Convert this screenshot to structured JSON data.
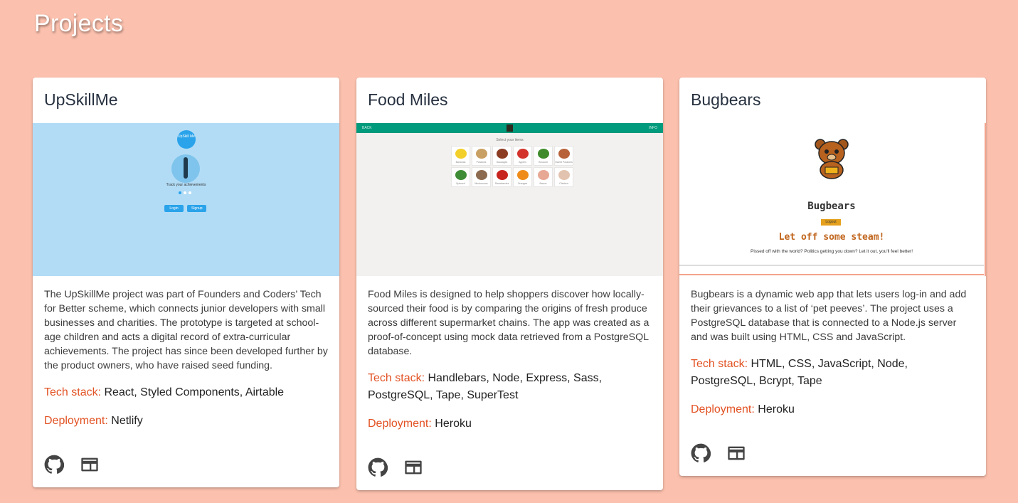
{
  "page": {
    "title": "Projects"
  },
  "colors": {
    "background": "#fcc1ae",
    "label": "#e25223",
    "card": "#ffffff"
  },
  "projects": [
    {
      "title": "UpSkillMe",
      "description": "The UpSkillMe project was part of Founders and Coders’ Tech for Better scheme, which connects junior developers with small businesses and charities. The prototype is targeted at school-age children and acts a digital record of extra-curricular achievements. The project has since been developed further by the product owners, who have raised seed funding.",
      "tech_label": "Tech stack:",
      "tech_stack": "React, Styled Components, Airtable",
      "deployment_label": "Deployment:",
      "deployment": "Netlify",
      "icons": [
        "github-icon",
        "web-app-icon"
      ],
      "preview": {
        "logo_text": "UpSkill Me",
        "tagline": "Track your achievements",
        "buttons": [
          "Login",
          "Signup"
        ]
      }
    },
    {
      "title": "Food Miles",
      "description": "Food Miles is designed to help shoppers discover how locally-sourced their food is by comparing the origins of fresh produce across different supermarket chains. The app was created as a proof-of-concept using mock data retrieved from a PostgreSQL database.",
      "tech_label": "Tech stack:",
      "tech_stack": "Handlebars, Node, Express, Sass, PostgreSQL, Tape, SuperTest",
      "deployment_label": "Deployment:",
      "deployment": "Heroku",
      "icons": [
        "github-icon",
        "web-app-icon"
      ],
      "preview": {
        "back": "BACK",
        "info": "INFO",
        "heading": "Select your items",
        "items": [
          "Bananas",
          "Potatoes",
          "Sausages",
          "Apples",
          "Broccoli",
          "Sweet Potatoes",
          "Spinach",
          "Mushrooms",
          "Strawberries",
          "Oranges",
          "Bacon",
          "Chicken"
        ],
        "item_colors": [
          "#f3cf2a",
          "#c9a064",
          "#8b3c22",
          "#d3332b",
          "#3f8b2c",
          "#b8623a",
          "#3e8d36",
          "#8c6a4f",
          "#c8241f",
          "#ef8c19",
          "#e7a894",
          "#e2c3b0"
        ]
      }
    },
    {
      "title": "Bugbears",
      "description": "Bugbears is a dynamic web app that lets users log-in and add their grievances to a list of ‘pet peeves’. The project uses a PostgreSQL database that is connected to a Node.js server and was built using HTML, CSS and JavaScript.",
      "tech_label": "Tech stack:",
      "tech_stack": "HTML, CSS, JavaScript, Node, PostgreSQL, Bcrypt, Tape",
      "deployment_label": "Deployment:",
      "deployment": "Heroku",
      "icons": [
        "github-icon",
        "web-app-icon"
      ],
      "preview": {
        "title": "Bugbears",
        "logout": "Logout",
        "slogan": "Let off some steam!",
        "small": "Pissed off with the world? Politics getting you down? Let it out, you'll feel better!"
      }
    }
  ]
}
